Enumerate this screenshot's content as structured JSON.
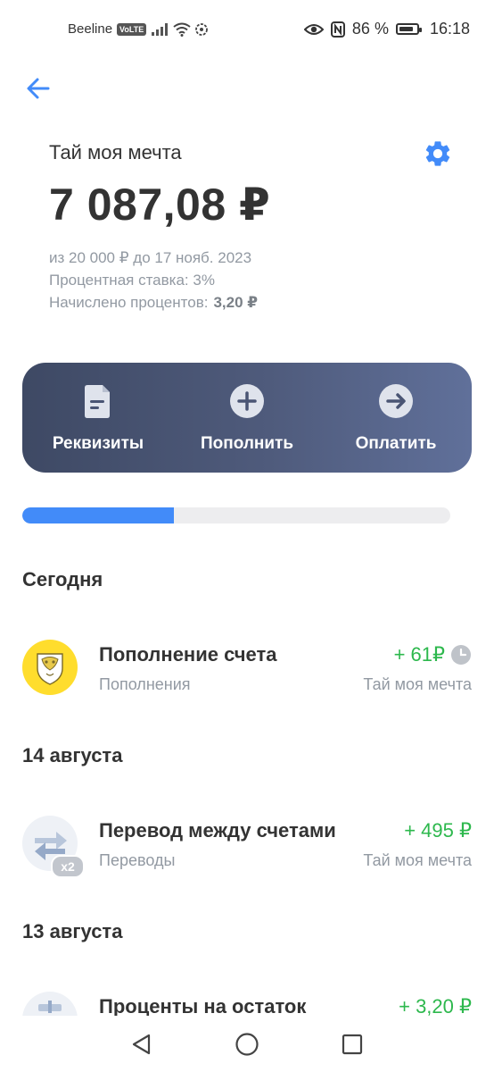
{
  "status_bar": {
    "carrier": "Beeline",
    "volte": "VoLTE",
    "battery_percent": "86 %",
    "battery_level": 0.86,
    "time": "16:18",
    "icons": [
      "signal-icon",
      "wifi-icon",
      "eye-icon",
      "nfc-icon",
      "battery-icon"
    ]
  },
  "header": {
    "back_icon": "arrow-left-icon",
    "settings_icon": "gear-icon",
    "title": "Тай моя мечта",
    "amount": "7 087,08 ₽",
    "goal_line": "из 20 000 ₽ до 17 нояб. 2023",
    "rate_line": "Процентная ставка: 3%",
    "accrued_label": "Начислено процентов:",
    "accrued_value": "3,20 ₽"
  },
  "actions": [
    {
      "label": "Реквизиты",
      "icon": "document-icon"
    },
    {
      "label": "Пополнить",
      "icon": "plus-circle-icon"
    },
    {
      "label": "Оплатить",
      "icon": "arrow-right-circle-icon"
    }
  ],
  "progress": {
    "fraction": 0.354
  },
  "colors": {
    "accent": "#428bf9",
    "positive": "#2db84d",
    "secondary_text": "#9299a2",
    "actions_bg_start": "#3e4964",
    "actions_bg_end": "#60709a"
  },
  "sections": [
    {
      "date": "Сегодня",
      "transactions": [
        {
          "name": "Пополнение счета",
          "category": "Пополнения",
          "amount": "+ 61₽",
          "account": "Тай моя мечта",
          "pending": true,
          "avatar": "bank-logo-icon"
        }
      ]
    },
    {
      "date": "14 августа",
      "transactions": [
        {
          "name": "Перевод между счетами",
          "category": "Переводы",
          "amount": "+ 495 ₽",
          "account": "Тай моя мечта",
          "badge": "x2",
          "avatar": "transfer-arrows-icon"
        }
      ]
    },
    {
      "date": "13 августа",
      "transactions": [
        {
          "name": "Проценты на остаток",
          "amount": "+ 3,20 ₽",
          "avatar": "gift-icon"
        }
      ]
    }
  ],
  "nav_bar": {
    "icons": [
      "back-triangle-icon",
      "home-circle-icon",
      "recents-square-icon"
    ]
  }
}
